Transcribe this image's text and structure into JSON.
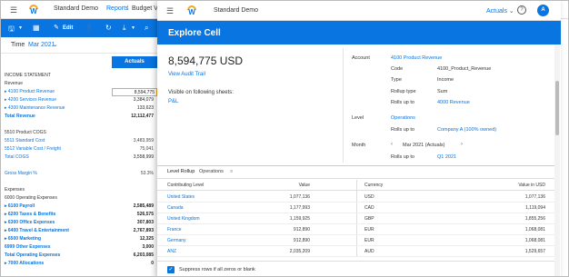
{
  "app": {
    "tenant": "Standard Demo",
    "breadcrumb": [
      "Reports",
      "Budget Variance"
    ],
    "filter": {
      "label": "Time",
      "value": "Mar 2021"
    },
    "toolbar": {
      "edit_label": "Edit"
    },
    "column_header": "Actuals",
    "rows": [
      {
        "label": "INCOME STATEMENT",
        "value": "",
        "style": "hdr"
      },
      {
        "label": "Revenue",
        "value": "",
        "style": "hdr"
      },
      {
        "label": "▸ 4100 Product Revenue",
        "value": "8,594,775",
        "style": "link sel"
      },
      {
        "label": "▸ 4200 Services Revenue",
        "value": "3,384,079",
        "style": "link"
      },
      {
        "label": "▸ 4300 Maintenance Revenue",
        "value": "133,623",
        "style": "link"
      },
      {
        "label": "Total Revenue",
        "value": "12,112,477",
        "style": "link bold"
      },
      {
        "label": "",
        "value": "",
        "style": ""
      },
      {
        "label": "5510 Product COGS",
        "value": "",
        "style": "hdr"
      },
      {
        "label": "5511 Standard Cost",
        "value": "3,483,959",
        "style": "link dim"
      },
      {
        "label": "5512 Variable Cost / Freight",
        "value": "75,041",
        "style": "link dim"
      },
      {
        "label": "Total COGS",
        "value": "3,558,999",
        "style": "link"
      },
      {
        "label": "",
        "value": "",
        "style": ""
      },
      {
        "label": "Gross Margin %",
        "value": "53.3%",
        "style": "link dim"
      },
      {
        "label": "",
        "value": "",
        "style": ""
      },
      {
        "label": "Expenses",
        "value": "",
        "style": "hdr"
      },
      {
        "label": "6000 Operating Expenses",
        "value": "",
        "style": "hdr"
      },
      {
        "label": "▸ 6100 Payroll",
        "value": "2,585,489",
        "style": "link bold"
      },
      {
        "label": "▸ 6200 Taxes & Benefits",
        "value": "526,575",
        "style": "link bold"
      },
      {
        "label": "▸ 6300 Office Expenses",
        "value": "307,803",
        "style": "link bold"
      },
      {
        "label": "▸ 6400 Travel & Entertainment",
        "value": "2,767,893",
        "style": "link bold"
      },
      {
        "label": "▸ 6500 Marketing",
        "value": "12,325",
        "style": "link bold"
      },
      {
        "label": "6999 Other Expenses",
        "value": "3,000",
        "style": "link bold"
      },
      {
        "label": "Total Operating Expenses",
        "value": "6,203,085",
        "style": "link bold"
      },
      {
        "label": "▸ 7000 Allocations",
        "value": "0",
        "style": "link bold"
      }
    ]
  },
  "modal": {
    "tenant": "Standard Demo",
    "scenario": "Actuals",
    "avatar": "A",
    "title": "Explore Cell",
    "value": "8,594,775 USD",
    "audit_link": "View Audit Trail",
    "visible_label": "Visible on following sheets:",
    "sheet_link": "P&L",
    "account": {
      "section": "Account",
      "name": "4100 Product Revenue",
      "code_k": "Code",
      "code_v": "4100_Product_Revenue",
      "type_k": "Type",
      "type_v": "Income",
      "rollup_type_k": "Rollup type",
      "rollup_type_v": "Sum",
      "rolls_up_k": "Rolls up to",
      "rolls_up_v": "4000 Revenue"
    },
    "level": {
      "section": "Level",
      "name": "Operations",
      "rolls_up_k": "Rolls up to",
      "rolls_up_v": "Company A (100% owned)"
    },
    "month": {
      "section": "Month",
      "value": "Mar 2021 (Actuals)",
      "rolls_up_k": "Rolls up to",
      "rolls_up_v": "Q1 2021"
    },
    "tabs": [
      "Level Rollup",
      "Operations",
      "≡"
    ],
    "grid": {
      "headers": [
        "Contributing Level",
        "Value",
        "Currency",
        "Value in USD"
      ],
      "rows": [
        [
          "United States",
          "1,077,136",
          "USD",
          "1,077,136"
        ],
        [
          "Canada",
          "1,177,993",
          "CAD",
          "1,119,094"
        ],
        [
          "United Kingdom",
          "1,159,925",
          "GBP",
          "1,855,256"
        ],
        [
          "France",
          "912,890",
          "EUR",
          "1,068,081"
        ],
        [
          "Germany",
          "912,890",
          "EUR",
          "1,068,081"
        ],
        [
          "ANZ",
          "2,035,209",
          "AUD",
          "1,529,657"
        ]
      ]
    },
    "suppress_label": "Suppress rows if all zeros or blank"
  }
}
